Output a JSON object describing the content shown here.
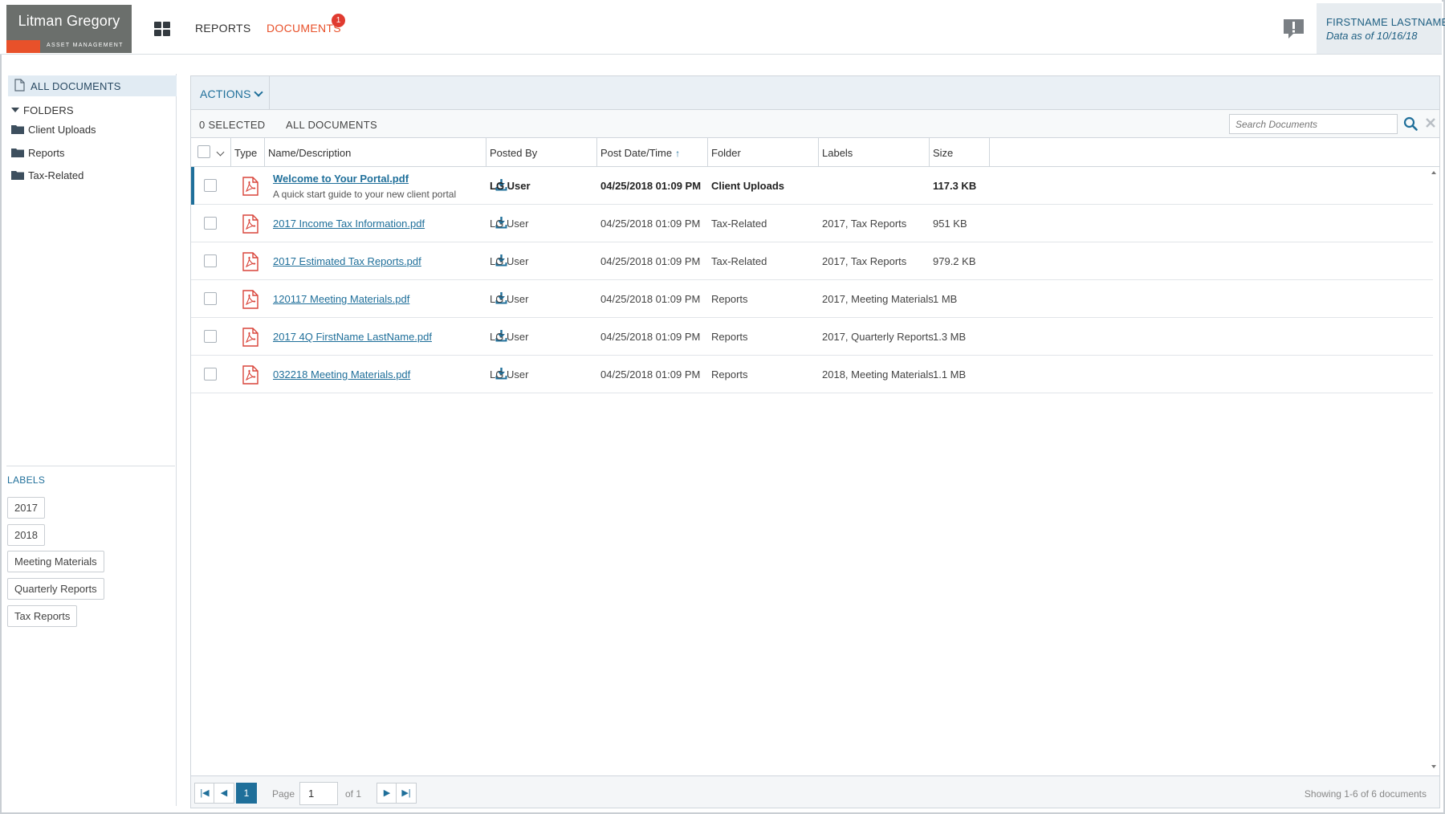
{
  "header": {
    "logo_name": "Litman Gregory",
    "logo_sub": "ASSET MANAGEMENT",
    "nav": {
      "reports": "REPORTS",
      "documents": "DOCUMENTS",
      "documents_badge": "1"
    },
    "user_name": "FIRSTNAME LASTNAME",
    "data_as_of": "Data as of 10/16/18",
    "colors": {
      "accent_orange": "#e8512a",
      "primary_blue": "#1f6f9a",
      "badge_red": "#e03b30"
    }
  },
  "sidebar": {
    "all_documents": "ALL DOCUMENTS",
    "folders_title": "FOLDERS",
    "folders": [
      "Client Uploads",
      "Reports",
      "Tax-Related"
    ],
    "labels_title": "LABELS",
    "labels": [
      "2017",
      "2018",
      "Meeting Materials",
      "Quarterly Reports",
      "Tax Reports"
    ]
  },
  "toolbar": {
    "actions": "ACTIONS",
    "selected_count": "0 SELECTED",
    "view": "ALL DOCUMENTS",
    "search_placeholder": "Search Documents"
  },
  "table": {
    "columns": {
      "type": "Type",
      "name": "Name/Description",
      "posted_by": "Posted By",
      "date": "Post Date/Time",
      "folder": "Folder",
      "labels": "Labels",
      "size": "Size"
    },
    "sort_indicator": "↑",
    "rows": [
      {
        "name": "Welcome to Your Portal.pdf",
        "desc": "A quick start guide to your new client portal",
        "posted_by": "LG User",
        "date": "04/25/2018 01:09 PM",
        "folder": "Client Uploads",
        "labels": "",
        "size": "117.3 KB"
      },
      {
        "name": "2017 Income Tax Information.pdf",
        "desc": "",
        "posted_by": "LG User",
        "date": "04/25/2018 01:09 PM",
        "folder": "Tax-Related",
        "labels": "2017, Tax Reports",
        "size": "951 KB"
      },
      {
        "name": "2017 Estimated Tax Reports.pdf",
        "desc": "",
        "posted_by": "LG User",
        "date": "04/25/2018 01:09 PM",
        "folder": "Tax-Related",
        "labels": "2017, Tax Reports",
        "size": "979.2 KB"
      },
      {
        "name": "120117 Meeting Materials.pdf",
        "desc": "",
        "posted_by": "LG User",
        "date": "04/25/2018 01:09 PM",
        "folder": "Reports",
        "labels": "2017, Meeting Materials",
        "size": "1 MB"
      },
      {
        "name": "2017 4Q FirstName LastName.pdf",
        "desc": "",
        "posted_by": "LG User",
        "date": "04/25/2018 01:09 PM",
        "folder": "Reports",
        "labels": "2017, Quarterly Reports",
        "size": "1.3 MB"
      },
      {
        "name": "032218 Meeting Materials.pdf",
        "desc": "",
        "posted_by": "LG User",
        "date": "04/25/2018 01:09 PM",
        "folder": "Reports",
        "labels": "2018, Meeting Materials",
        "size": "1.1 MB"
      }
    ]
  },
  "pager": {
    "current": "1",
    "page_label": "Page",
    "page_value": "1",
    "of_label": "of 1",
    "status": "Showing 1-6 of 6 documents"
  }
}
